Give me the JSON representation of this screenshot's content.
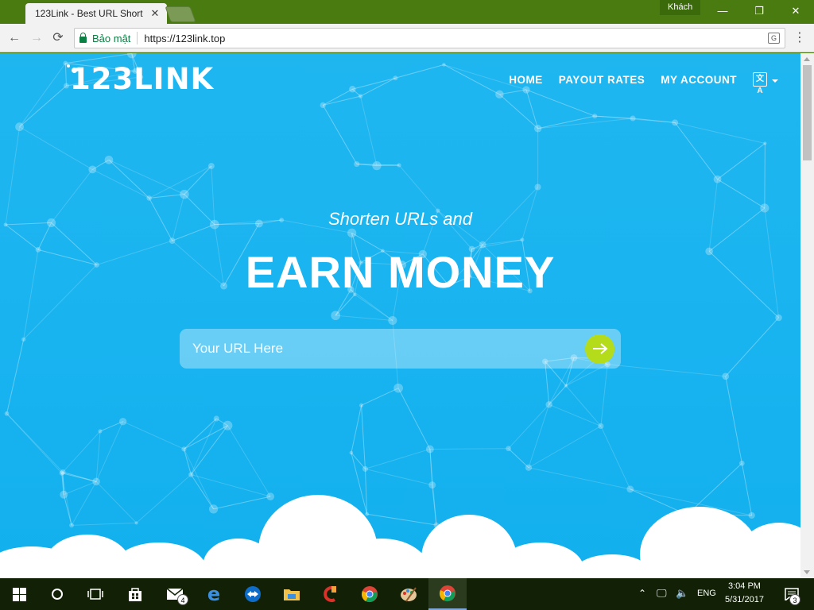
{
  "browser": {
    "tab_title": "123Link - Best URL Short",
    "tab_close": "✕",
    "profile_label": "Khách",
    "window_controls": {
      "minimize": "—",
      "maximize": "❐",
      "close": "✕"
    },
    "nav": {
      "back": "←",
      "forward": "→",
      "reload": "⟳",
      "menu": "⋮"
    },
    "security_label": "Bảo mật",
    "url": "https://123link.top",
    "translate_icon": "G"
  },
  "site": {
    "logo": "123LINK",
    "nav_links": [
      "HOME",
      "PAYOUT RATES",
      "MY ACCOUNT"
    ],
    "lang_icon_text": "文A",
    "hero_subtitle": "Shorten URLs and",
    "hero_title": "EARN MONEY",
    "url_input_placeholder": "Your URL Here"
  },
  "taskbar": {
    "mail_badge": "4",
    "language": "ENG",
    "time": "3:04 PM",
    "date": "5/31/2017",
    "notification_count": "3"
  },
  "colors": {
    "page_bg": "#19b4f0",
    "go_button": "#b4dc1b",
    "window_frame": "#4a7b10",
    "taskbar_bg": "#122006"
  }
}
